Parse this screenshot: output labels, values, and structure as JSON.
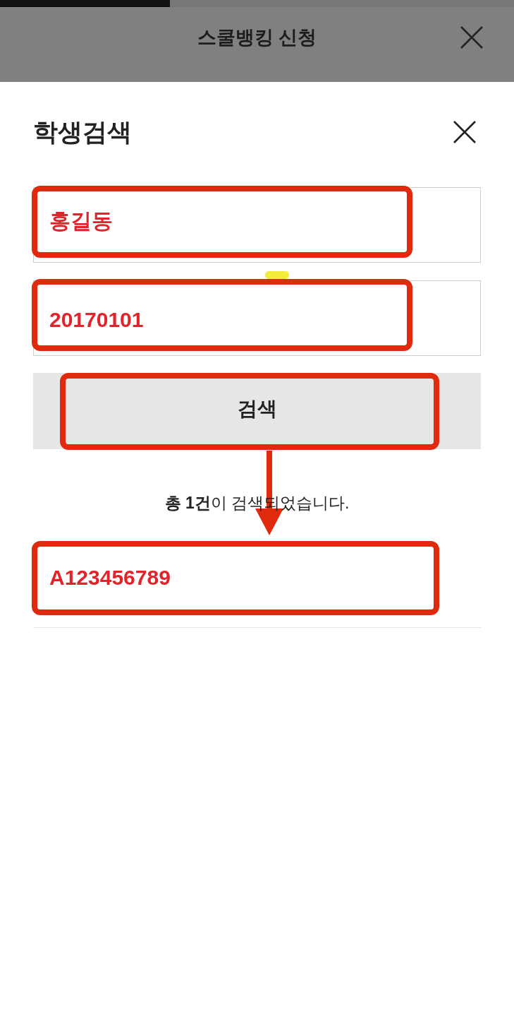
{
  "header": {
    "progress": {
      "level": 0.33
    },
    "title": "스쿨뱅킹 신청"
  },
  "dialog": {
    "title": "학생검색",
    "fields": [
      {
        "value": "홍길동",
        "highlighted": true
      },
      {
        "value": "20170101",
        "highlighted": true
      }
    ],
    "search_button": {
      "label": "검색",
      "highlighted": true
    },
    "result_summary": "**총 1건**이 검색되었습니다.",
    "results": [
      {
        "value": "A123456789",
        "highlighted": true
      }
    ]
  }
}
